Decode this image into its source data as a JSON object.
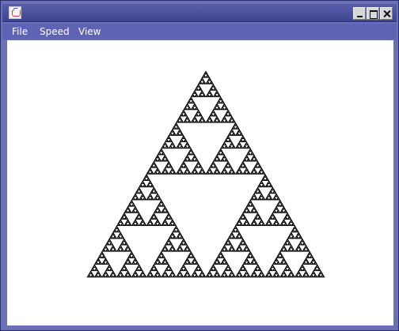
{
  "window": {
    "title": ""
  },
  "menu": {
    "items": [
      "File",
      "Speed",
      "View"
    ]
  },
  "fractal": {
    "name": "sierpinski-triangle",
    "depth": 7,
    "fill": "#000000",
    "background": "#ffffff"
  }
}
